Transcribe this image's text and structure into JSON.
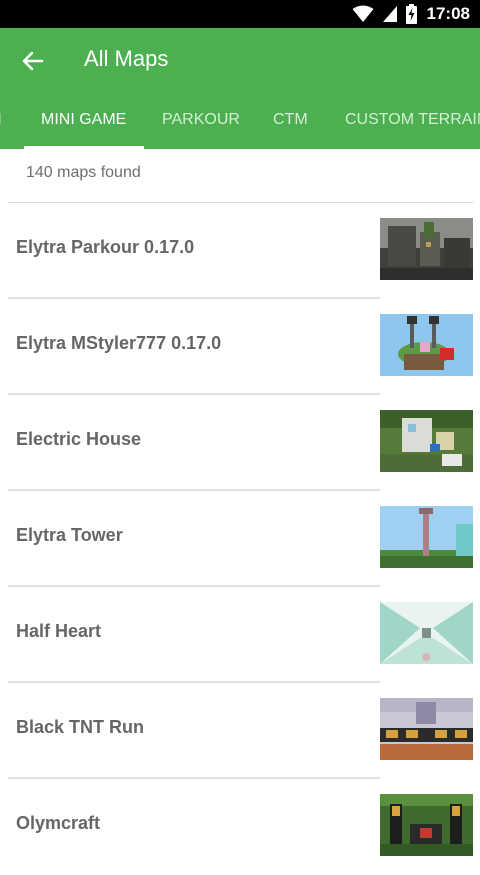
{
  "status_bar": {
    "time": "17:08"
  },
  "app_bar": {
    "title": "All Maps"
  },
  "tabs": [
    {
      "label": "MINI GAME",
      "active": true
    },
    {
      "label": "PARKOUR",
      "active": false
    },
    {
      "label": "CTM",
      "active": false
    },
    {
      "label": "CUSTOM TERRAIN",
      "active": false
    }
  ],
  "results": {
    "count_text": "140 maps found"
  },
  "maps": [
    {
      "title": "Elytra Parkour 0.17.0"
    },
    {
      "title": "Elytra MStyler777 0.17.0"
    },
    {
      "title": "Electric House"
    },
    {
      "title": "Elytra Tower"
    },
    {
      "title": "Half Heart"
    },
    {
      "title": "Black TNT Run"
    },
    {
      "title": "Olymcraft"
    }
  ],
  "colors": {
    "primary": "#4caf50",
    "title_text": "#666666",
    "divider": "#e0e0e0"
  }
}
